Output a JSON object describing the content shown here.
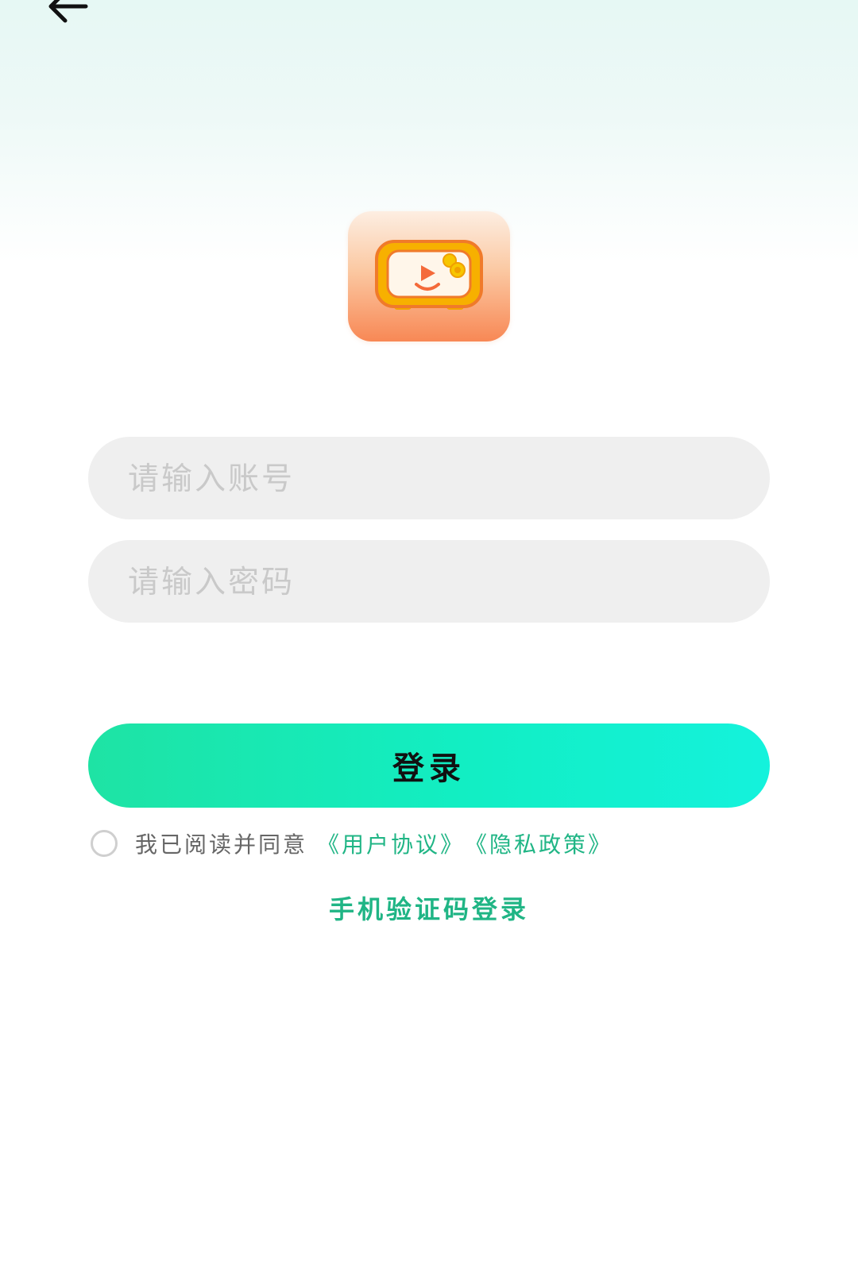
{
  "header": {
    "back_icon": "arrow-left-icon"
  },
  "logo": {
    "icon": "tv-play-icon"
  },
  "form": {
    "account_placeholder": "请输入账号",
    "password_placeholder": "请输入密码",
    "account_value": "",
    "password_value": "",
    "login_label": "登录"
  },
  "agreement": {
    "checked": false,
    "text": "我已阅读并同意",
    "user_agreement": "《用户协议》",
    "privacy_policy": "《隐私政策》"
  },
  "alt_login": {
    "label": "手机验证码登录"
  },
  "colors": {
    "accent_green": "#20b585",
    "button_gradient_start": "#1ee3a4",
    "button_gradient_end": "#14f2dc",
    "input_bg": "#efefef",
    "logo_orange": "#f88855"
  }
}
